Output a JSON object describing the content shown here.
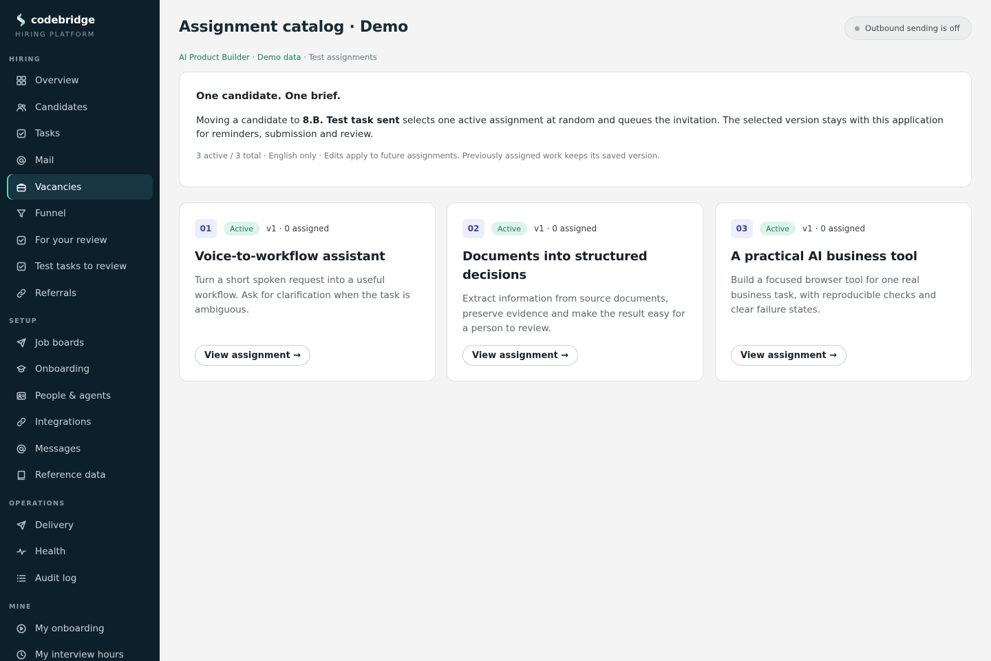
{
  "brand": {
    "name": "codebridge",
    "subtitle": "HIRING PLATFORM"
  },
  "sidebar": {
    "sections": [
      {
        "label": "HIRING",
        "items": [
          {
            "label": "Overview",
            "icon": "grid-icon"
          },
          {
            "label": "Candidates",
            "icon": "users-icon"
          },
          {
            "label": "Tasks",
            "icon": "checkbox-icon"
          },
          {
            "label": "Mail",
            "icon": "at-icon"
          },
          {
            "label": "Vacancies",
            "icon": "briefcase-icon",
            "active": true
          },
          {
            "label": "Funnel",
            "icon": "funnel-icon"
          },
          {
            "label": "For your review",
            "icon": "checkbox-icon"
          },
          {
            "label": "Test tasks to review",
            "icon": "checkbox-icon"
          },
          {
            "label": "Referrals",
            "icon": "link-icon"
          }
        ]
      },
      {
        "label": "SETUP",
        "items": [
          {
            "label": "Job boards",
            "icon": "send-icon"
          },
          {
            "label": "Onboarding",
            "icon": "graduation-icon"
          },
          {
            "label": "People & agents",
            "icon": "id-card-icon"
          },
          {
            "label": "Integrations",
            "icon": "link-icon"
          },
          {
            "label": "Messages",
            "icon": "at-icon"
          },
          {
            "label": "Reference data",
            "icon": "book-icon"
          }
        ]
      },
      {
        "label": "OPERATIONS",
        "items": [
          {
            "label": "Delivery",
            "icon": "send-icon"
          },
          {
            "label": "Health",
            "icon": "pulse-icon"
          },
          {
            "label": "Audit log",
            "icon": "list-icon"
          }
        ]
      },
      {
        "label": "MINE",
        "items": [
          {
            "label": "My onboarding",
            "icon": "play-circle-icon"
          },
          {
            "label": "My interview hours",
            "icon": "clock-icon"
          }
        ]
      }
    ]
  },
  "header": {
    "title": "Assignment catalog · Demo",
    "status": "Outbound sending is off",
    "status_color": "#9aa3a9"
  },
  "breadcrumb": {
    "link1": "AI Product Builder",
    "sep1": " · ",
    "link2": "Demo data",
    "sep2": " · ",
    "current": "Test assignments"
  },
  "intro": {
    "title": "One candidate. One brief.",
    "body_before": "Moving a candidate to ",
    "body_bold": "8.B. Test task sent",
    "body_after": " selects one active assignment at random and queues the invitation. The selected version stays with this application for reminders, submission and review.",
    "meta": "3 active / 3 total · English only · Edits apply to future assignments. Previously assigned work keeps its saved version."
  },
  "cards": [
    {
      "number": "01",
      "status": "Active",
      "meta": "v1 · 0 assigned",
      "title": "Voice-to-workflow assistant",
      "description": "Turn a short spoken request into a useful workflow. Ask for clarification when the task is ambiguous.",
      "button": "View assignment →"
    },
    {
      "number": "02",
      "status": "Active",
      "meta": "v1 · 0 assigned",
      "title": "Documents into structured decisions",
      "description": "Extract information from source documents, preserve evidence and make the result easy for a person to review.",
      "button": "View assignment →"
    },
    {
      "number": "03",
      "status": "Active",
      "meta": "v1 · 0 assigned",
      "title": "A practical AI business tool",
      "description": "Build a focused browser tool for one real business task, with reproducible checks and clear failure states.",
      "button": "View assignment →"
    }
  ],
  "colors": {
    "sidebar_bg": "#0d1f2a",
    "accent": "#1d7d64",
    "active_indicator": "#5fd3b6",
    "badge_bg": "#dcf4ea"
  }
}
